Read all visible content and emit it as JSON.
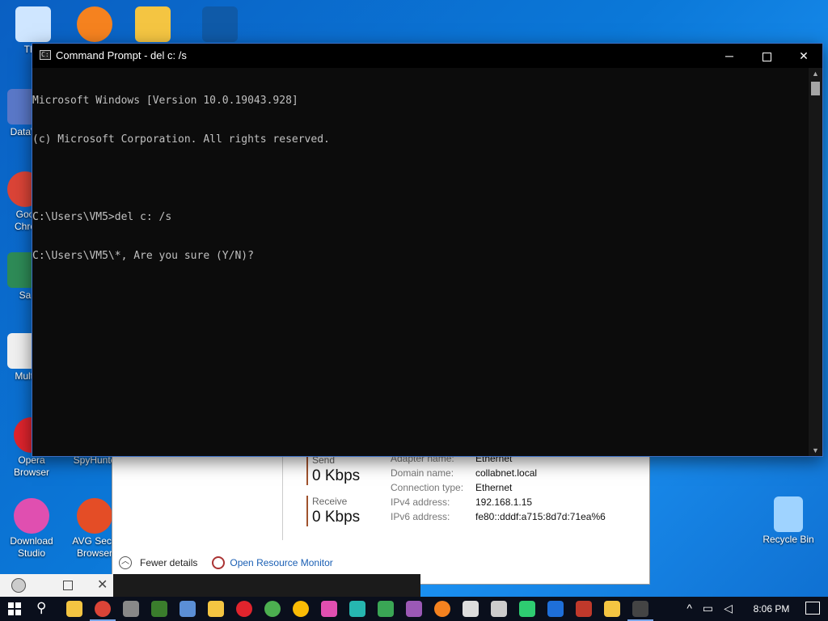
{
  "desktop": {
    "icons": [
      {
        "label": "This",
        "color": "#cfe6ff"
      },
      {
        "label": "",
        "color": "#f5821f"
      },
      {
        "label": "",
        "color": "#f4c542"
      },
      {
        "label": "",
        "color": "#0f5aa8"
      },
      {
        "label": "DataW",
        "color": "#5a78c8"
      },
      {
        "label": "Goo\nChro",
        "color": "#db4437"
      },
      {
        "label": "Sa",
        "color": "#2e8b57"
      },
      {
        "label": "Multi",
        "color": "#f0f0f0"
      },
      {
        "label": "Opera\nBrowser",
        "color": "#e0242d"
      },
      {
        "label": "SpyHunte",
        "color": "#1f3d7a"
      },
      {
        "label": "Download\nStudio",
        "color": "#e04fb0"
      },
      {
        "label": "AVG Secu\nBrowser",
        "color": "#e44d26"
      },
      {
        "label": "Recycle Bin",
        "color": "#9fd3ff"
      }
    ]
  },
  "cmd": {
    "title": "Command Prompt - del  c: /s",
    "lines": [
      "Microsoft Windows [Version 10.0.19043.928]",
      "(c) Microsoft Corporation. All rights reserved.",
      "",
      "C:\\Users\\VM5>del c: /s",
      "C:\\Users\\VM5\\*, Are you sure (Y/N)?"
    ],
    "minimize": "─",
    "close": "✕"
  },
  "taskmgr": {
    "send_label": "Send",
    "send_value": "0 Kbps",
    "receive_label": "Receive",
    "receive_value": "0 Kbps",
    "props": [
      {
        "k": "Adapter name:",
        "v": "Ethernet"
      },
      {
        "k": "Domain name:",
        "v": "collabnet.local"
      },
      {
        "k": "Connection type:",
        "v": "Ethernet"
      },
      {
        "k": "IPv4 address:",
        "v": "192.168.1.15"
      },
      {
        "k": "IPv6 address:",
        "v": "fe80::dddf:a715:8d7d:71ea%6"
      }
    ],
    "fewer_details": "Fewer details",
    "open_resource_monitor": "Open Resource Monitor",
    "chevron": "︿"
  },
  "preview": {
    "close": "✕"
  },
  "taskbar": {
    "search_glyph": "⚲",
    "apps": [
      {
        "name": "file-explorer",
        "color": "#f4c542"
      },
      {
        "name": "chrome",
        "color": "#db4437"
      },
      {
        "name": "app3",
        "color": "#888888"
      },
      {
        "name": "app4",
        "color": "#3a7d2c"
      },
      {
        "name": "app5",
        "color": "#5b8fd6"
      },
      {
        "name": "app6",
        "color": "#f4c542"
      },
      {
        "name": "opera",
        "color": "#e0242d"
      },
      {
        "name": "utorrent",
        "color": "#4caf50"
      },
      {
        "name": "chrome2",
        "color": "#fbbc05"
      },
      {
        "name": "app10",
        "color": "#e04fb0"
      },
      {
        "name": "app11",
        "color": "#26b6b0"
      },
      {
        "name": "app12",
        "color": "#3aa655"
      },
      {
        "name": "app13",
        "color": "#9b59b6"
      },
      {
        "name": "avast",
        "color": "#f5821f"
      },
      {
        "name": "shield",
        "color": "#dddddd"
      },
      {
        "name": "settings",
        "color": "#cccccc"
      },
      {
        "name": "defender",
        "color": "#2ecc71"
      },
      {
        "name": "app18",
        "color": "#1e6fd9"
      },
      {
        "name": "app19",
        "color": "#c0392b"
      },
      {
        "name": "notepad",
        "color": "#f4c542"
      },
      {
        "name": "cmd",
        "color": "#444444"
      }
    ],
    "tray_up": "^",
    "clock": "8:06 PM"
  }
}
